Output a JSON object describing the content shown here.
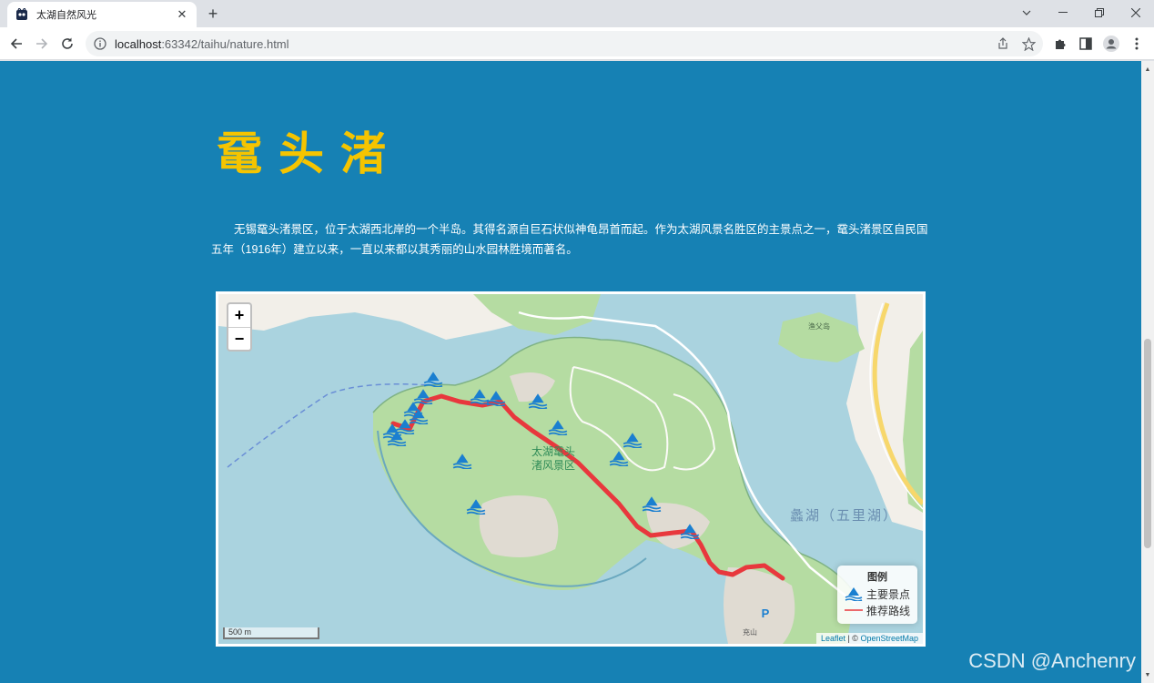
{
  "browser": {
    "tab_title": "太湖自然风光",
    "url_host": "localhost",
    "url_rest": ":63342/taihu/nature.html"
  },
  "page": {
    "heading": "鼋头渚",
    "intro": "无锡鼋头渚景区，位于太湖西北岸的一个半岛。其得名源自巨石状似神龟昂首而起。作为太湖风景名胜区的主景点之一，鼋头渚景区自民国五年（1916年）建立以来，一直以来都以其秀丽的山水园林胜境而著名。"
  },
  "map": {
    "zoom_in": "+",
    "zoom_out": "−",
    "scale_label": "500 m",
    "attribution_leaflet": "Leaflet",
    "attribution_sep": " | © ",
    "attribution_osm": "OpenStreetMap",
    "area_label_line1": "太湖鼋头",
    "area_label_line2": "渚风景区",
    "lake_label": "蠡湖（五里湖）",
    "parking_label": "P",
    "hill_label": "充山",
    "island_label": "渔父岛",
    "legend": {
      "title": "图例",
      "spot_label": "主要景点",
      "route_label": "推荐路线"
    },
    "colors": {
      "water": "#aad3df",
      "land": "#b5dca2",
      "route": "#e8383d",
      "marker": "#1a7fd0"
    }
  },
  "watermark": "CSDN @Anchenry"
}
